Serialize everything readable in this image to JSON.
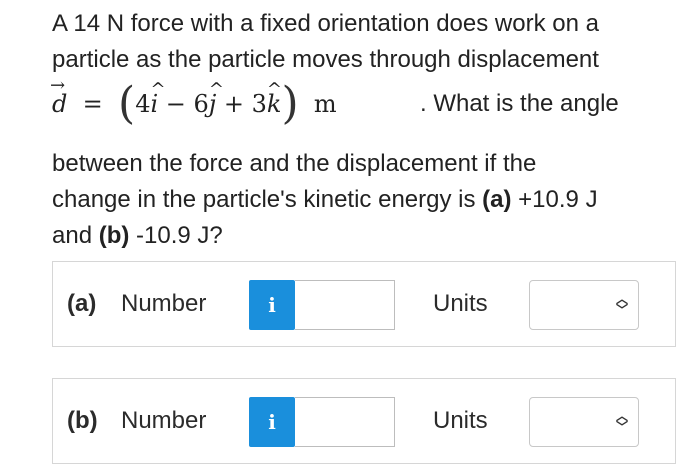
{
  "question": {
    "line1": "A 14 N force with a fixed orientation does work on a",
    "line2": "particle as the particle moves through displacement",
    "math": {
      "vector_symbol": "d",
      "arrow": "→",
      "equals": "=",
      "open_paren": "(",
      "term1_coef": "4",
      "term1_unit": "i",
      "op1": " − ",
      "term2_coef": "6",
      "term2_unit": "j",
      "op2": " + ",
      "term3_coef": "3",
      "term3_unit": "k",
      "close_paren": ")",
      "unit": "m",
      "hat": "^"
    },
    "line3_tail": ". What is the angle",
    "line4": "between the force and the displacement if the",
    "line5_start": "change in the particle's kinetic energy is ",
    "line5_a": "(a)",
    "line5_end": " +10.9 J",
    "line6_start": "and ",
    "line6_b": "(b)",
    "line6_end": " -10.9 J?"
  },
  "answers": [
    {
      "part": "(a)",
      "number_label": "Number",
      "info_icon": "i",
      "number_value": "",
      "units_label": "Units",
      "units_value": ""
    },
    {
      "part": "(b)",
      "number_label": "Number",
      "info_icon": "i",
      "number_value": "",
      "units_label": "Units",
      "units_value": ""
    }
  ],
  "icons": {
    "info": "info-icon",
    "select": "chevron-updown-icon"
  },
  "colors": {
    "info_button": "#1a8fdc",
    "text": "#222222",
    "border": "#d6d6d6"
  }
}
